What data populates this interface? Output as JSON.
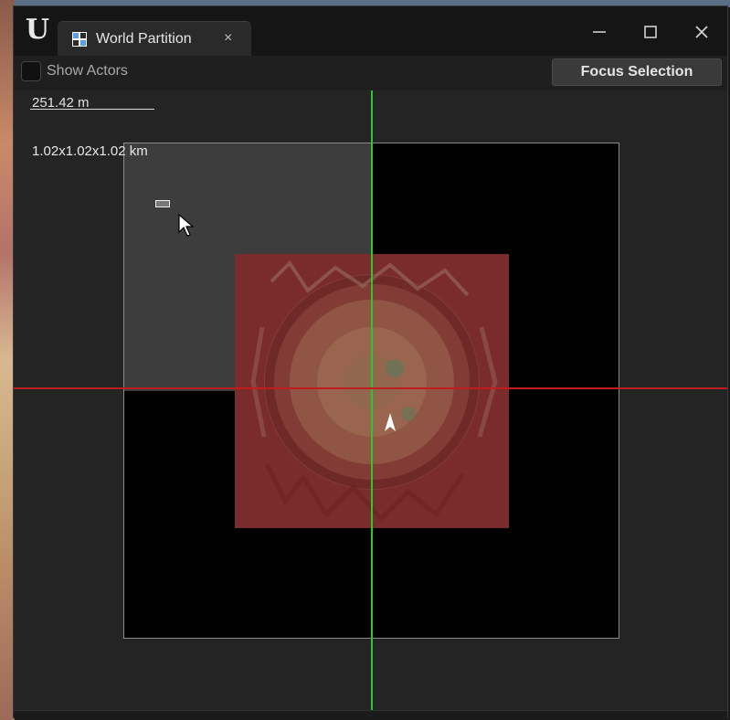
{
  "window": {
    "tab_title": "World Partition",
    "tab_close_glyph": "×"
  },
  "toolbar": {
    "show_actors_label": "Show Actors",
    "show_actors_checked": false,
    "focus_selection_label": "Focus Selection"
  },
  "viewport": {
    "scale_label": "251.42 m",
    "world_size_label": "1.02x1.02x1.02 km"
  },
  "icons": {
    "app_logo": "unreal-engine-logo",
    "tab_icon": "grid-icon",
    "minimize": "minimize-icon",
    "maximize": "maximize-icon",
    "close": "close-icon"
  },
  "colors": {
    "x_axis": "#c01e1e",
    "y_axis": "#2ec52e",
    "landscape": "#7a2b2b",
    "loaded_region": "#878787"
  }
}
